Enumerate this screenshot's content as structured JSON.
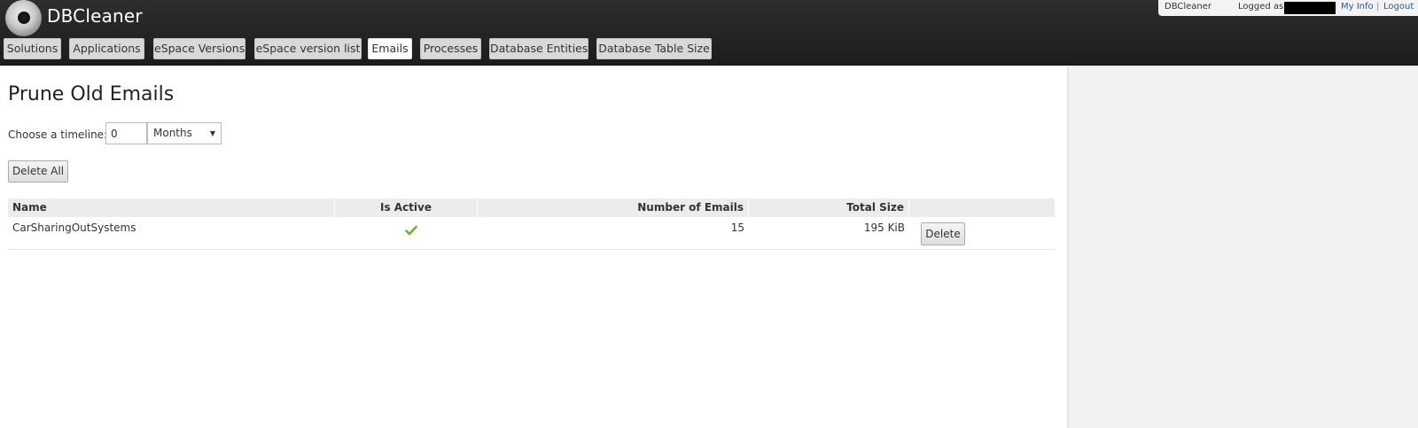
{
  "app": {
    "title": "DBCleaner"
  },
  "userbox": {
    "app_name": "DBCleaner",
    "logged_as": "Logged as",
    "my_info": "My Info",
    "separator": "|",
    "logout": "Logout"
  },
  "tabs": [
    {
      "label": "Solutions",
      "active": false
    },
    {
      "label": "Applications",
      "active": false
    },
    {
      "label": "eSpace Versions",
      "active": false
    },
    {
      "label": "eSpace version list",
      "active": false
    },
    {
      "label": "Emails",
      "active": true
    },
    {
      "label": "Processes",
      "active": false
    },
    {
      "label": "Database Entities",
      "active": false
    },
    {
      "label": "Database Table Size",
      "active": false
    }
  ],
  "main": {
    "title": "Prune Old Emails",
    "timeline_label": "Choose a timeline:",
    "timeline_value": "0",
    "timeline_unit": "Months",
    "delete_all_label": "Delete All"
  },
  "table": {
    "headers": {
      "name": "Name",
      "is_active": "Is Active",
      "number_of_emails": "Number of Emails",
      "total_size": "Total Size"
    },
    "rows": [
      {
        "name": "CarSharingOutSystems",
        "is_active": true,
        "number_of_emails": "15",
        "total_size": "195 KiB",
        "action_label": "Delete"
      }
    ]
  },
  "colors": {
    "header_bg": "#242424",
    "link": "#2a5aa0",
    "check": "#6ab52e"
  },
  "icons": {
    "logo": "disc-logo-icon",
    "active": "checkmark-icon",
    "dropdown": "triangle-down-icon"
  }
}
